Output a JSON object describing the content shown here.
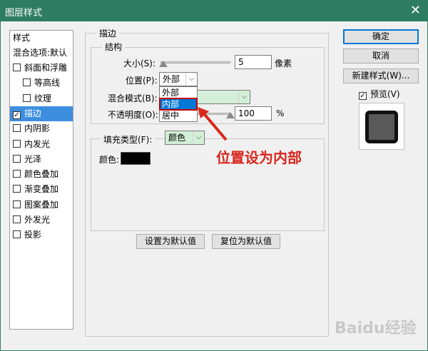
{
  "window": {
    "title": "图层样式",
    "close_glyph": "✕"
  },
  "style_list": {
    "header": "样式",
    "blend_options": "混合选项:默认",
    "items": [
      {
        "label": "斜面和浮雕",
        "checked": false
      },
      {
        "label": "等高线",
        "checked": false,
        "indent": true
      },
      {
        "label": "纹理",
        "checked": false,
        "indent": true
      },
      {
        "label": "描边",
        "checked": true,
        "selected": true
      },
      {
        "label": "内阴影",
        "checked": false
      },
      {
        "label": "内发光",
        "checked": false
      },
      {
        "label": "光泽",
        "checked": false
      },
      {
        "label": "颜色叠加",
        "checked": false
      },
      {
        "label": "渐变叠加",
        "checked": false
      },
      {
        "label": "图案叠加",
        "checked": false
      },
      {
        "label": "外发光",
        "checked": false
      },
      {
        "label": "投影",
        "checked": false
      }
    ]
  },
  "stroke": {
    "section_title": "描边",
    "structure_title": "结构",
    "size_label": "大小(S):",
    "size_value": "5",
    "size_unit": "像素",
    "position_label": "位置(P):",
    "position_value": "外部",
    "position_options": [
      "外部",
      "内部",
      "居中"
    ],
    "position_highlight": "内部",
    "blend_label": "混合模式(B):",
    "opacity_label": "不透明度(O):",
    "opacity_value": "100",
    "opacity_unit": "%",
    "fill_type_label": "填充类型(F):",
    "fill_type_value": "颜色",
    "color_label": "颜色:",
    "color_swatch": "#000000",
    "set_default_button": "设置为默认值",
    "reset_default_button": "复位为默认值"
  },
  "right_panel": {
    "ok_button": "确定",
    "cancel_button": "取消",
    "new_style_button": "新建样式(W)...",
    "preview_label": "预览(V)",
    "preview_checked": true
  },
  "annotation": {
    "text": "位置设为内部",
    "color": "#d9261c"
  },
  "watermark": {
    "text": "Baidu经验"
  },
  "colors": {
    "titlebar": "#2e7d63",
    "selection": "#3e8ee0",
    "highlight_border": "#c00000"
  }
}
